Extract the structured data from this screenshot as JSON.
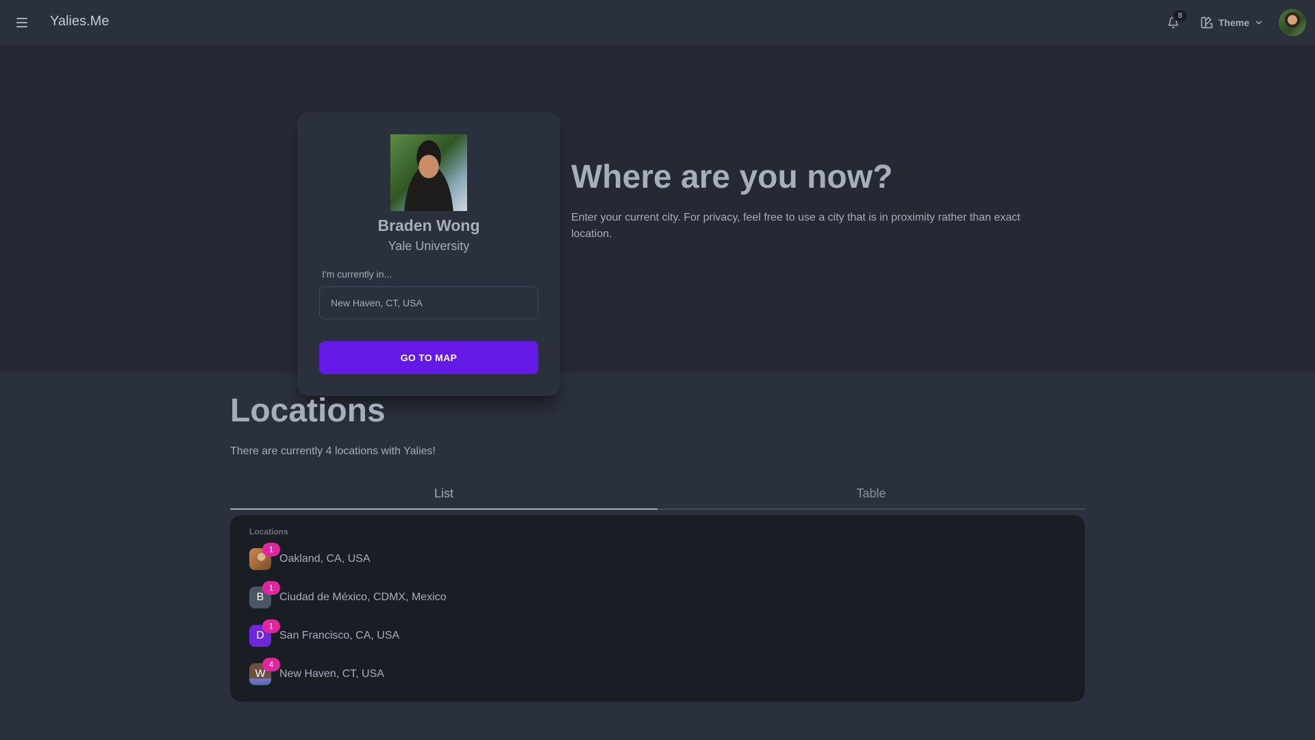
{
  "navbar": {
    "brand": "Yalies.Me",
    "notification_count": "8",
    "theme_label": "Theme"
  },
  "profile": {
    "name": "Braden Wong",
    "school": "Yale University",
    "input_label": "I'm currently in...",
    "input_value": "New Haven, CT, USA",
    "button_label": "GO TO MAP"
  },
  "hero": {
    "title": "Where are you now?",
    "description": "Enter your current city. For privacy, feel free to use a city that is in proximity rather than exact location."
  },
  "locations": {
    "title": "Locations",
    "description": "There are currently 4 locations with Yalies!",
    "tabs": [
      "List",
      "Table"
    ],
    "active_tab": "List",
    "list_heading": "Locations",
    "items": [
      {
        "name": "Oakland, CA, USA",
        "count": "1",
        "initial": "",
        "avatar_color": "#b07a4e"
      },
      {
        "name": "Ciudad de México, CDMX, Mexico",
        "count": "1",
        "initial": "B",
        "avatar_color": "#4b5563"
      },
      {
        "name": "San Francisco, CA, USA",
        "count": "1",
        "initial": "D",
        "avatar_color": "#6d28d9"
      },
      {
        "name": "New Haven, CT, USA",
        "count": "4",
        "initial": "W",
        "avatar_color": "#6b4f3f"
      }
    ]
  },
  "colors": {
    "primary": "#6419e6",
    "badge": "#e0259e"
  }
}
